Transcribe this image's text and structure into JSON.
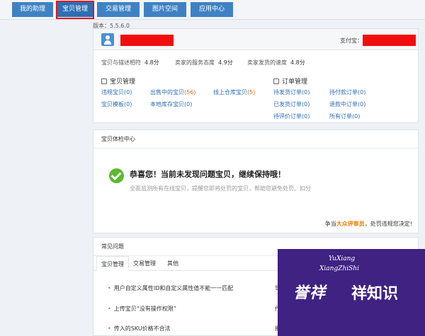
{
  "nav": {
    "tabs": [
      "我的助理",
      "宝贝管理",
      "交易管理",
      "图片空间",
      "应用中心"
    ]
  },
  "version": "版本：5.5.6.0",
  "account": {
    "alipay_label": "支付宝："
  },
  "scores": [
    {
      "label": "宝贝与描述相符",
      "value": "4.8分"
    },
    {
      "label": "卖家的服务态度",
      "value": "4.9分"
    },
    {
      "label": "卖家发货的速度",
      "value": "4.8分"
    }
  ],
  "item_mgmt": {
    "title": "宝贝管理",
    "links": [
      {
        "label": "违规宝贝",
        "count": "(0)"
      },
      {
        "label": "出售中的宝贝",
        "count": "(56)"
      },
      {
        "label": "线上仓库宝贝",
        "count": "(5)"
      },
      {
        "label": "宝贝模板",
        "count": "(0)"
      },
      {
        "label": "本地库存宝贝",
        "count": "(0)"
      }
    ]
  },
  "order_mgmt": {
    "title": "订单管理",
    "links": [
      {
        "label": "待发货订单",
        "count": "(0)"
      },
      {
        "label": "待付款订单",
        "count": "(0)"
      },
      {
        "label": "已发货订单",
        "count": "(0)"
      },
      {
        "label": "退款中订单",
        "count": "(0)"
      },
      {
        "label": "待评价订单",
        "count": "(0)"
      },
      {
        "label": "所有订单",
        "count": "(0)"
      }
    ]
  },
  "health": {
    "title": "宝贝体检中心",
    "headline": "恭喜您！当前未发现问题宝贝，继续保持哦！",
    "subtext": "全面监测所有在线宝贝，提醒您即将处罚的宝贝，帮助您避免处罚、扣分",
    "promo_prefix": "争当",
    "promo_highlight": "大众评审员",
    "promo_suffix": "，处罚违规您决定!"
  },
  "faq": {
    "title": "常见问题",
    "tabs": [
      "宝贝管理",
      "交易管理",
      "其他"
    ],
    "items": [
      "用户自定义属性ID和自定义属性值不能一一匹配",
      "上传宝贝“没有操作权限”",
      "传入的SKU价格不合法"
    ],
    "right_items": [
      "导",
      "作",
      "批"
    ]
  },
  "watermark": {
    "line1": "YuXiang",
    "line2": "XiangZhiShi",
    "line3": "誉祥",
    "line4": "祥知识"
  },
  "colors": {
    "tab_blue": "#3f82c4",
    "highlight_outline": "#e0131a",
    "redaction": "#f10d0d",
    "link": "#2a6cb7",
    "count_orange": "#e36b1e",
    "success_green": "#5cba2e",
    "promo_orange": "#e67e00",
    "watermark_purple": "#3f2282"
  }
}
